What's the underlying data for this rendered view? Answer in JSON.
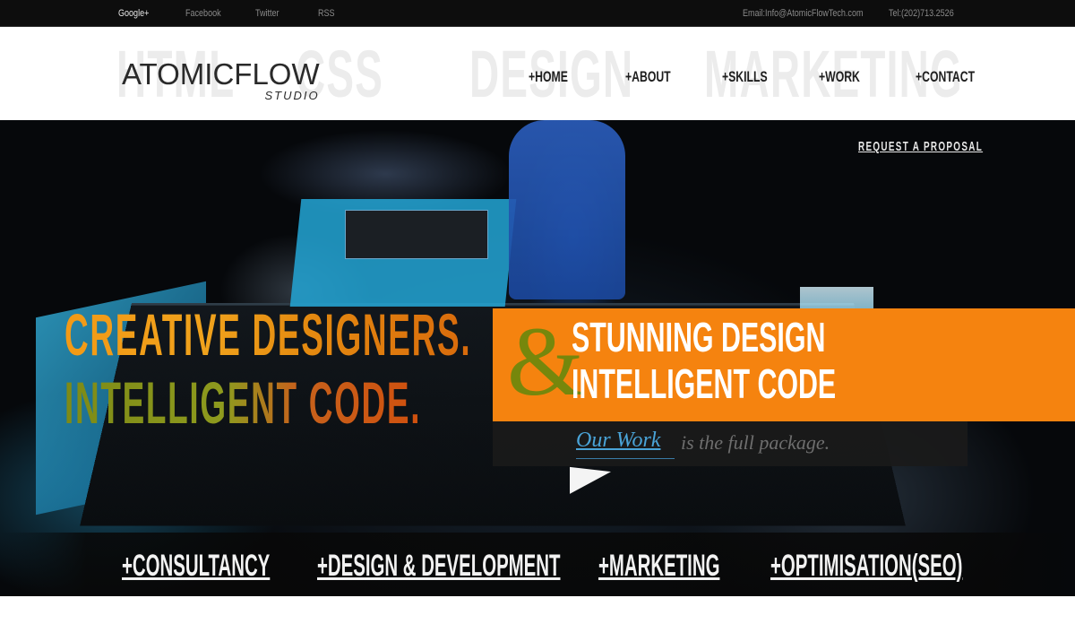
{
  "topbar": {
    "links": [
      "Google+",
      "Facebook",
      "Twitter",
      "RSS"
    ],
    "email": "Email:Info@AtomicFlowTech.com",
    "phone": "Tel:(202)713.2526"
  },
  "header": {
    "logo_main": "ATOMICFLOW",
    "logo_sub": "STUDIO",
    "background_words": [
      "HTML",
      "CSS",
      "DESIGN",
      "MARKETING"
    ],
    "nav": [
      "+HOME",
      "+ABOUT",
      "+SKILLS",
      "+WORK",
      "+CONTACT"
    ]
  },
  "hero": {
    "request_label": "REQUEST A PROPOSAL",
    "headline_line1": "CREATIVE DESIGNERS.",
    "headline_line2": "INTELLIGENT CODE.",
    "ampersand": "&",
    "tagline_line1": "STUNNING DESIGN",
    "tagline_line2": "INTELLIGENT CODE",
    "our_work": "Our Work",
    "full_package": "is the full package."
  },
  "services": [
    "+CONSULTANCY",
    "+DESIGN & DEVELOPMENT",
    "+MARKETING",
    "+OPTIMISATION(SEO)"
  ],
  "colors": {
    "accent_orange": "#f5830f",
    "olive": "#76870c",
    "link_blue": "#4aa4d8",
    "topbar_bg": "#0d0d0d"
  }
}
